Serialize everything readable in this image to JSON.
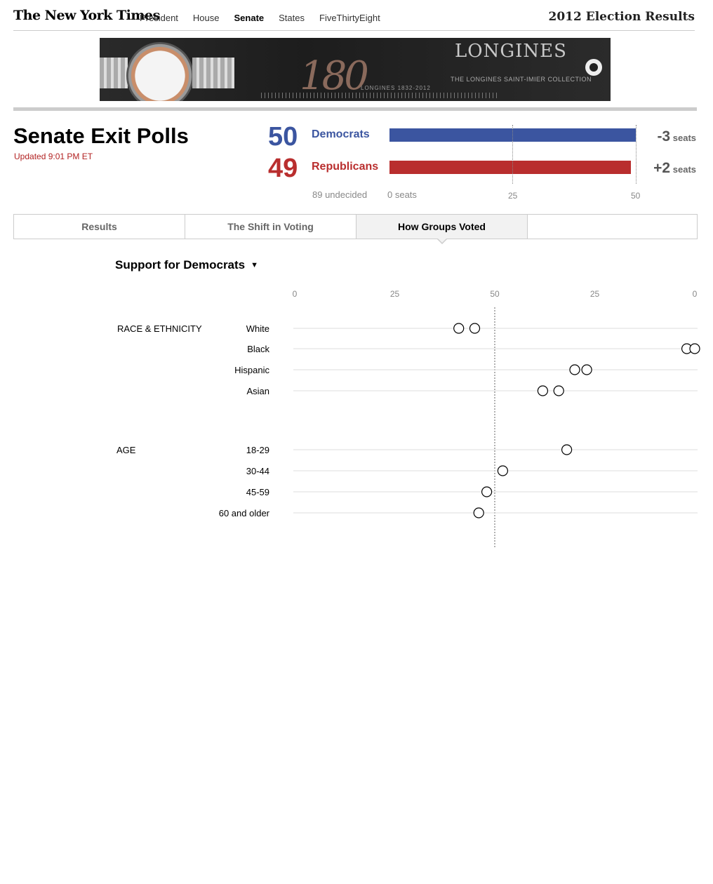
{
  "header": {
    "logo": "The New York Times",
    "nav": [
      {
        "label": "President",
        "active": false
      },
      {
        "label": "House",
        "active": false
      },
      {
        "label": "Senate",
        "active": true
      },
      {
        "label": "States",
        "active": false
      },
      {
        "label": "FiveThirtyEight",
        "active": false
      }
    ],
    "edition_title": "2012 Election Results"
  },
  "ad": {
    "number": "180",
    "years": "LONGINES 1832-2012",
    "brand": "LONGINES",
    "collection": "THE LONGINES SAINT-IMIER COLLECTION"
  },
  "summary": {
    "title": "Senate Exit Polls",
    "updated": "Updated 9:01 PM ET",
    "democrats": {
      "seats": 50,
      "seats_text": "50",
      "label": "Democrats",
      "change": "-3",
      "change_unit": "seats"
    },
    "republicans": {
      "seats": 49,
      "seats_text": "49",
      "label": "Republicans",
      "change": "+2",
      "change_unit": "seats"
    },
    "undecided": "89 undecided",
    "axis": {
      "ticks": [
        "0 seats",
        "25",
        "50"
      ],
      "max": 50
    }
  },
  "colors": {
    "democrat": "#3b55a0",
    "republican": "#b92e2e",
    "updated": "#b22222"
  },
  "tabs": [
    {
      "label": "Results",
      "active": false
    },
    {
      "label": "The Shift in Voting",
      "active": false
    },
    {
      "label": "How Groups Voted",
      "active": true
    },
    {
      "label": "",
      "active": false
    }
  ],
  "metric_select": {
    "label": "Support for Democrats",
    "caret": "▼"
  },
  "chart_data": {
    "type": "scatter",
    "axis_ticks": [
      {
        "label": "0",
        "pos": 0
      },
      {
        "label": "25",
        "pos": 25
      },
      {
        "label": "50",
        "pos": 50
      },
      {
        "label": "25",
        "pos": 75
      },
      {
        "label": "0",
        "pos": 100
      }
    ],
    "xlim": [
      0,
      100
    ],
    "midline": 50,
    "groups": [
      {
        "name": "RACE & ETHNICITY",
        "rows": [
          {
            "label": "White",
            "values": [
              41,
              45
            ]
          },
          {
            "label": "Black",
            "values": [
              98,
              100
            ]
          },
          {
            "label": "Hispanic",
            "values": [
              70,
              73
            ]
          },
          {
            "label": "Asian",
            "values": [
              62,
              66
            ]
          }
        ]
      },
      {
        "name": "AGE",
        "rows": [
          {
            "label": "18-29",
            "values": [
              68
            ]
          },
          {
            "label": "30-44",
            "values": [
              52
            ]
          },
          {
            "label": "45-59",
            "values": [
              48
            ]
          },
          {
            "label": "60 and older",
            "values": [
              46
            ]
          }
        ]
      }
    ]
  }
}
